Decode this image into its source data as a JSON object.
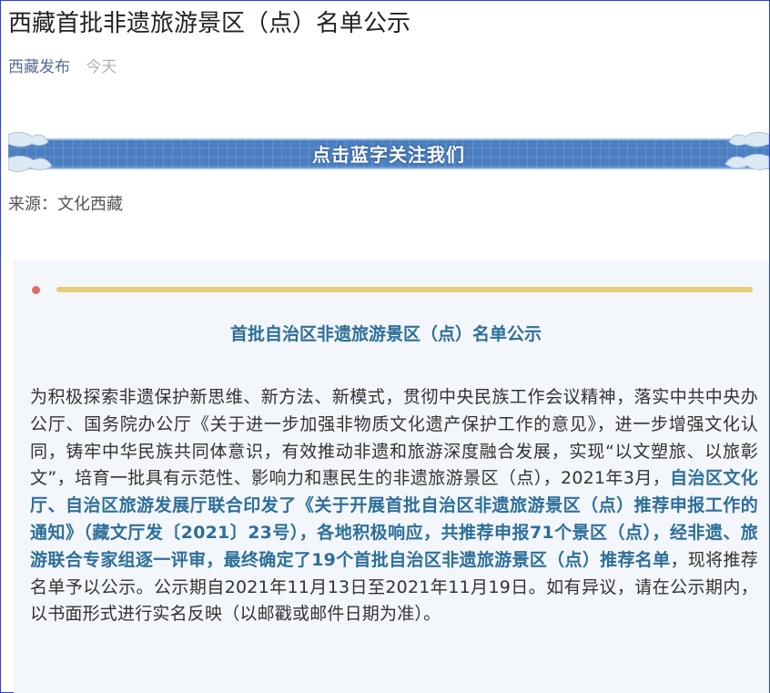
{
  "article": {
    "title": "西藏首批非遗旅游景区（点）名单公示",
    "account": "西藏发布",
    "time": "今天"
  },
  "banner": {
    "text": "点击蓝字关注我们"
  },
  "source": "来源：文化西藏",
  "card": {
    "title": "首批自治区非遗旅游景区（点）名单公示",
    "paragraph_part1": "为积极探索非遗保护新思维、新方法、新模式，贯彻中央民族工作会议精神，落实中共中央办公厅、国务院办公厅《关于进一步加强非物质文化遗产保护工作的意见》，进一步增强文化认同，铸牢中华民族共同体意识，有效推动非遗和旅游深度融合发展，实现“以文塑旅、以旅彰文”，培育一批具有示范性、影响力和惠民生的非遗旅游景区（点），2021年3月，",
    "paragraph_highlight": "自治区文化厅、自治区旅游发展厅联合印发了《关于开展首批自治区非遗旅游景区（点）推荐申报工作的通知》（藏文厅发〔2021〕23号），各地积极响应，共推荐申报71个景区（点），经非遗、旅游联合专家组逐一评审，最终确定了19个首批自治区非遗旅游景区（点）推荐名单",
    "paragraph_part2": "，现将推荐名单予以公示。公示期自2021年11月13日至2021年11月19日。如有异议，请在公示期内，以书面形式进行实名反映（以邮戳或邮件日期为准）。"
  },
  "colors": {
    "accent_blue": "#2d6f99",
    "account_link": "#576b95",
    "bar_gold": "#eacb78",
    "dot_red": "#e26a6a",
    "card_bg": "#f3f6fa"
  },
  "icons": [
    "cloud-icon-left",
    "cloud-icon-right"
  ]
}
